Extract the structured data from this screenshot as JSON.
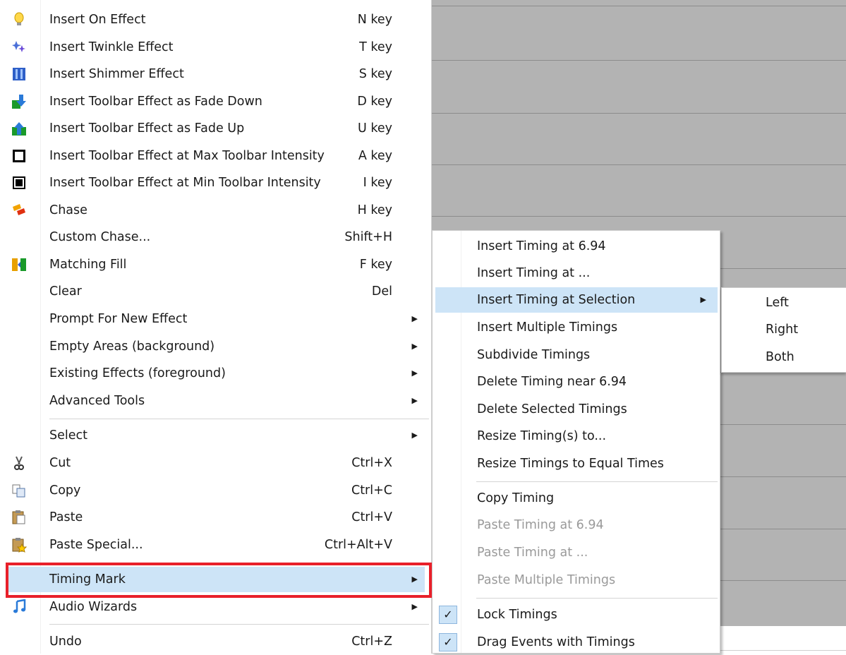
{
  "main_menu": {
    "items": [
      {
        "label": "Insert On Effect",
        "shortcut": "N key",
        "icon": "bulb-icon"
      },
      {
        "label": "Insert Twinkle Effect",
        "shortcut": "T key",
        "icon": "twinkle-icon"
      },
      {
        "label": "Insert Shimmer Effect",
        "shortcut": "S key",
        "icon": "shimmer-icon"
      },
      {
        "label": "Insert Toolbar Effect as Fade Down",
        "shortcut": "D key",
        "icon": "fade-down-icon"
      },
      {
        "label": "Insert Toolbar Effect as Fade Up",
        "shortcut": "U key",
        "icon": "fade-up-icon"
      },
      {
        "label": "Insert Toolbar Effect at Max Toolbar Intensity",
        "shortcut": "A key",
        "icon": "max-intensity-icon"
      },
      {
        "label": "Insert Toolbar Effect at Min Toolbar Intensity",
        "shortcut": "I key",
        "icon": "min-intensity-icon"
      },
      {
        "label": "Chase",
        "shortcut": "H key",
        "icon": "chase-icon"
      },
      {
        "label": "Custom Chase...",
        "shortcut": "Shift+H"
      },
      {
        "label": "Matching Fill",
        "shortcut": "F key",
        "icon": "matching-fill-icon"
      },
      {
        "label": "Clear",
        "shortcut": "Del"
      },
      {
        "label": "Prompt For New Effect",
        "submenu": true
      },
      {
        "label": "Empty Areas (background)",
        "submenu": true
      },
      {
        "label": "Existing Effects (foreground)",
        "submenu": true
      },
      {
        "label": "Advanced Tools",
        "submenu": true
      },
      {
        "label": "Select",
        "submenu": true
      },
      {
        "label": "Cut",
        "shortcut": "Ctrl+X",
        "icon": "scissors-icon"
      },
      {
        "label": "Copy",
        "shortcut": "Ctrl+C",
        "icon": "copy-icon"
      },
      {
        "label": "Paste",
        "shortcut": "Ctrl+V",
        "icon": "paste-icon"
      },
      {
        "label": "Paste Special...",
        "shortcut": "Ctrl+Alt+V",
        "icon": "paste-special-icon"
      },
      {
        "label": "Timing Mark",
        "submenu": true,
        "highlighted": true
      },
      {
        "label": "Audio Wizards",
        "submenu": true,
        "icon": "music-note-icon"
      },
      {
        "label": "Undo",
        "shortcut": "Ctrl+Z"
      }
    ]
  },
  "timing_submenu": {
    "items": [
      {
        "label": "Insert Timing at 6.94"
      },
      {
        "label": "Insert Timing at ..."
      },
      {
        "label": "Insert Timing at Selection",
        "submenu": true,
        "highlighted": true
      },
      {
        "label": "Insert Multiple Timings"
      },
      {
        "label": "Subdivide Timings"
      },
      {
        "label": "Delete Timing near 6.94"
      },
      {
        "label": "Delete Selected Timings"
      },
      {
        "label": "Resize Timing(s) to..."
      },
      {
        "label": "Resize Timings to Equal Times"
      },
      {
        "label": "Copy Timing"
      },
      {
        "label": "Paste Timing at 6.94",
        "disabled": true
      },
      {
        "label": "Paste Timing at ...",
        "disabled": true
      },
      {
        "label": "Paste Multiple Timings",
        "disabled": true
      },
      {
        "label": "Lock Timings",
        "checked": true
      },
      {
        "label": "Drag Events with Timings",
        "checked": true
      }
    ]
  },
  "selection_submenu": {
    "items": [
      {
        "label": "Left"
      },
      {
        "label": "Right"
      },
      {
        "label": "Both"
      }
    ]
  },
  "arrow_glyph": "▶",
  "check_glyph": "✓",
  "colors": {
    "highlight": "#cde4f7",
    "annotation_box": "#e8202a",
    "background_panel": "#b3b3b3"
  }
}
